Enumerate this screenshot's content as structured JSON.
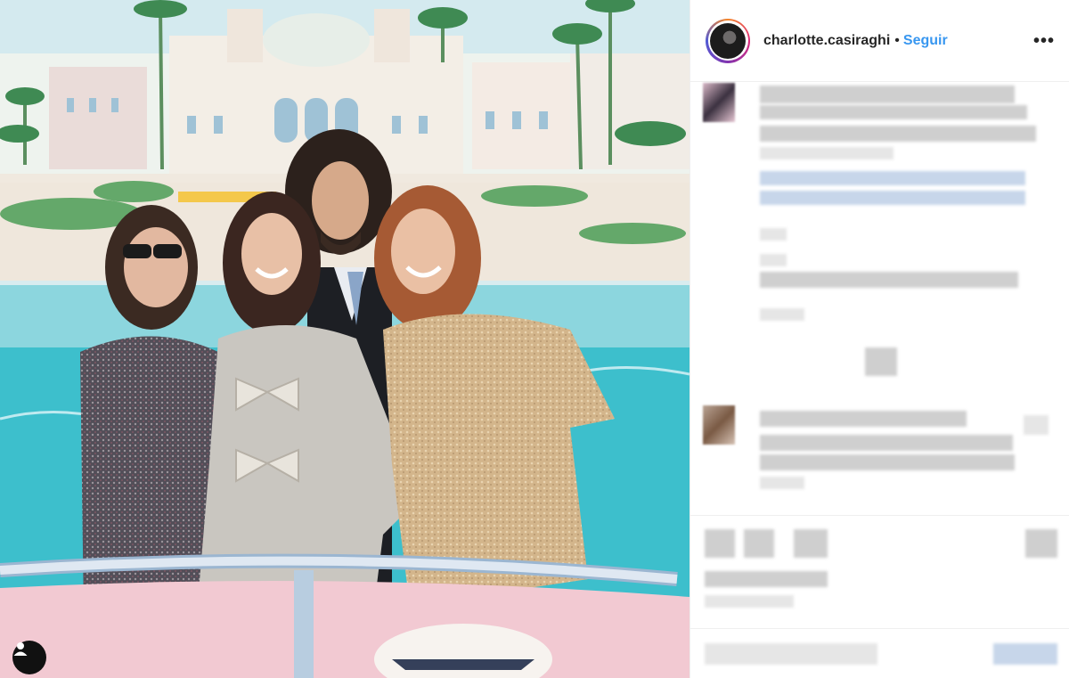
{
  "post": {
    "username": "charlotte.casiraghi",
    "separator": "•",
    "follow_label": "Seguir",
    "more_label": "•••"
  },
  "icons": {
    "more": "more-horizontal-icon",
    "user_tag": "user-tag-icon"
  },
  "colors": {
    "follow_blue": "#3897f0",
    "text_dark": "#262626",
    "border": "#efefef"
  }
}
